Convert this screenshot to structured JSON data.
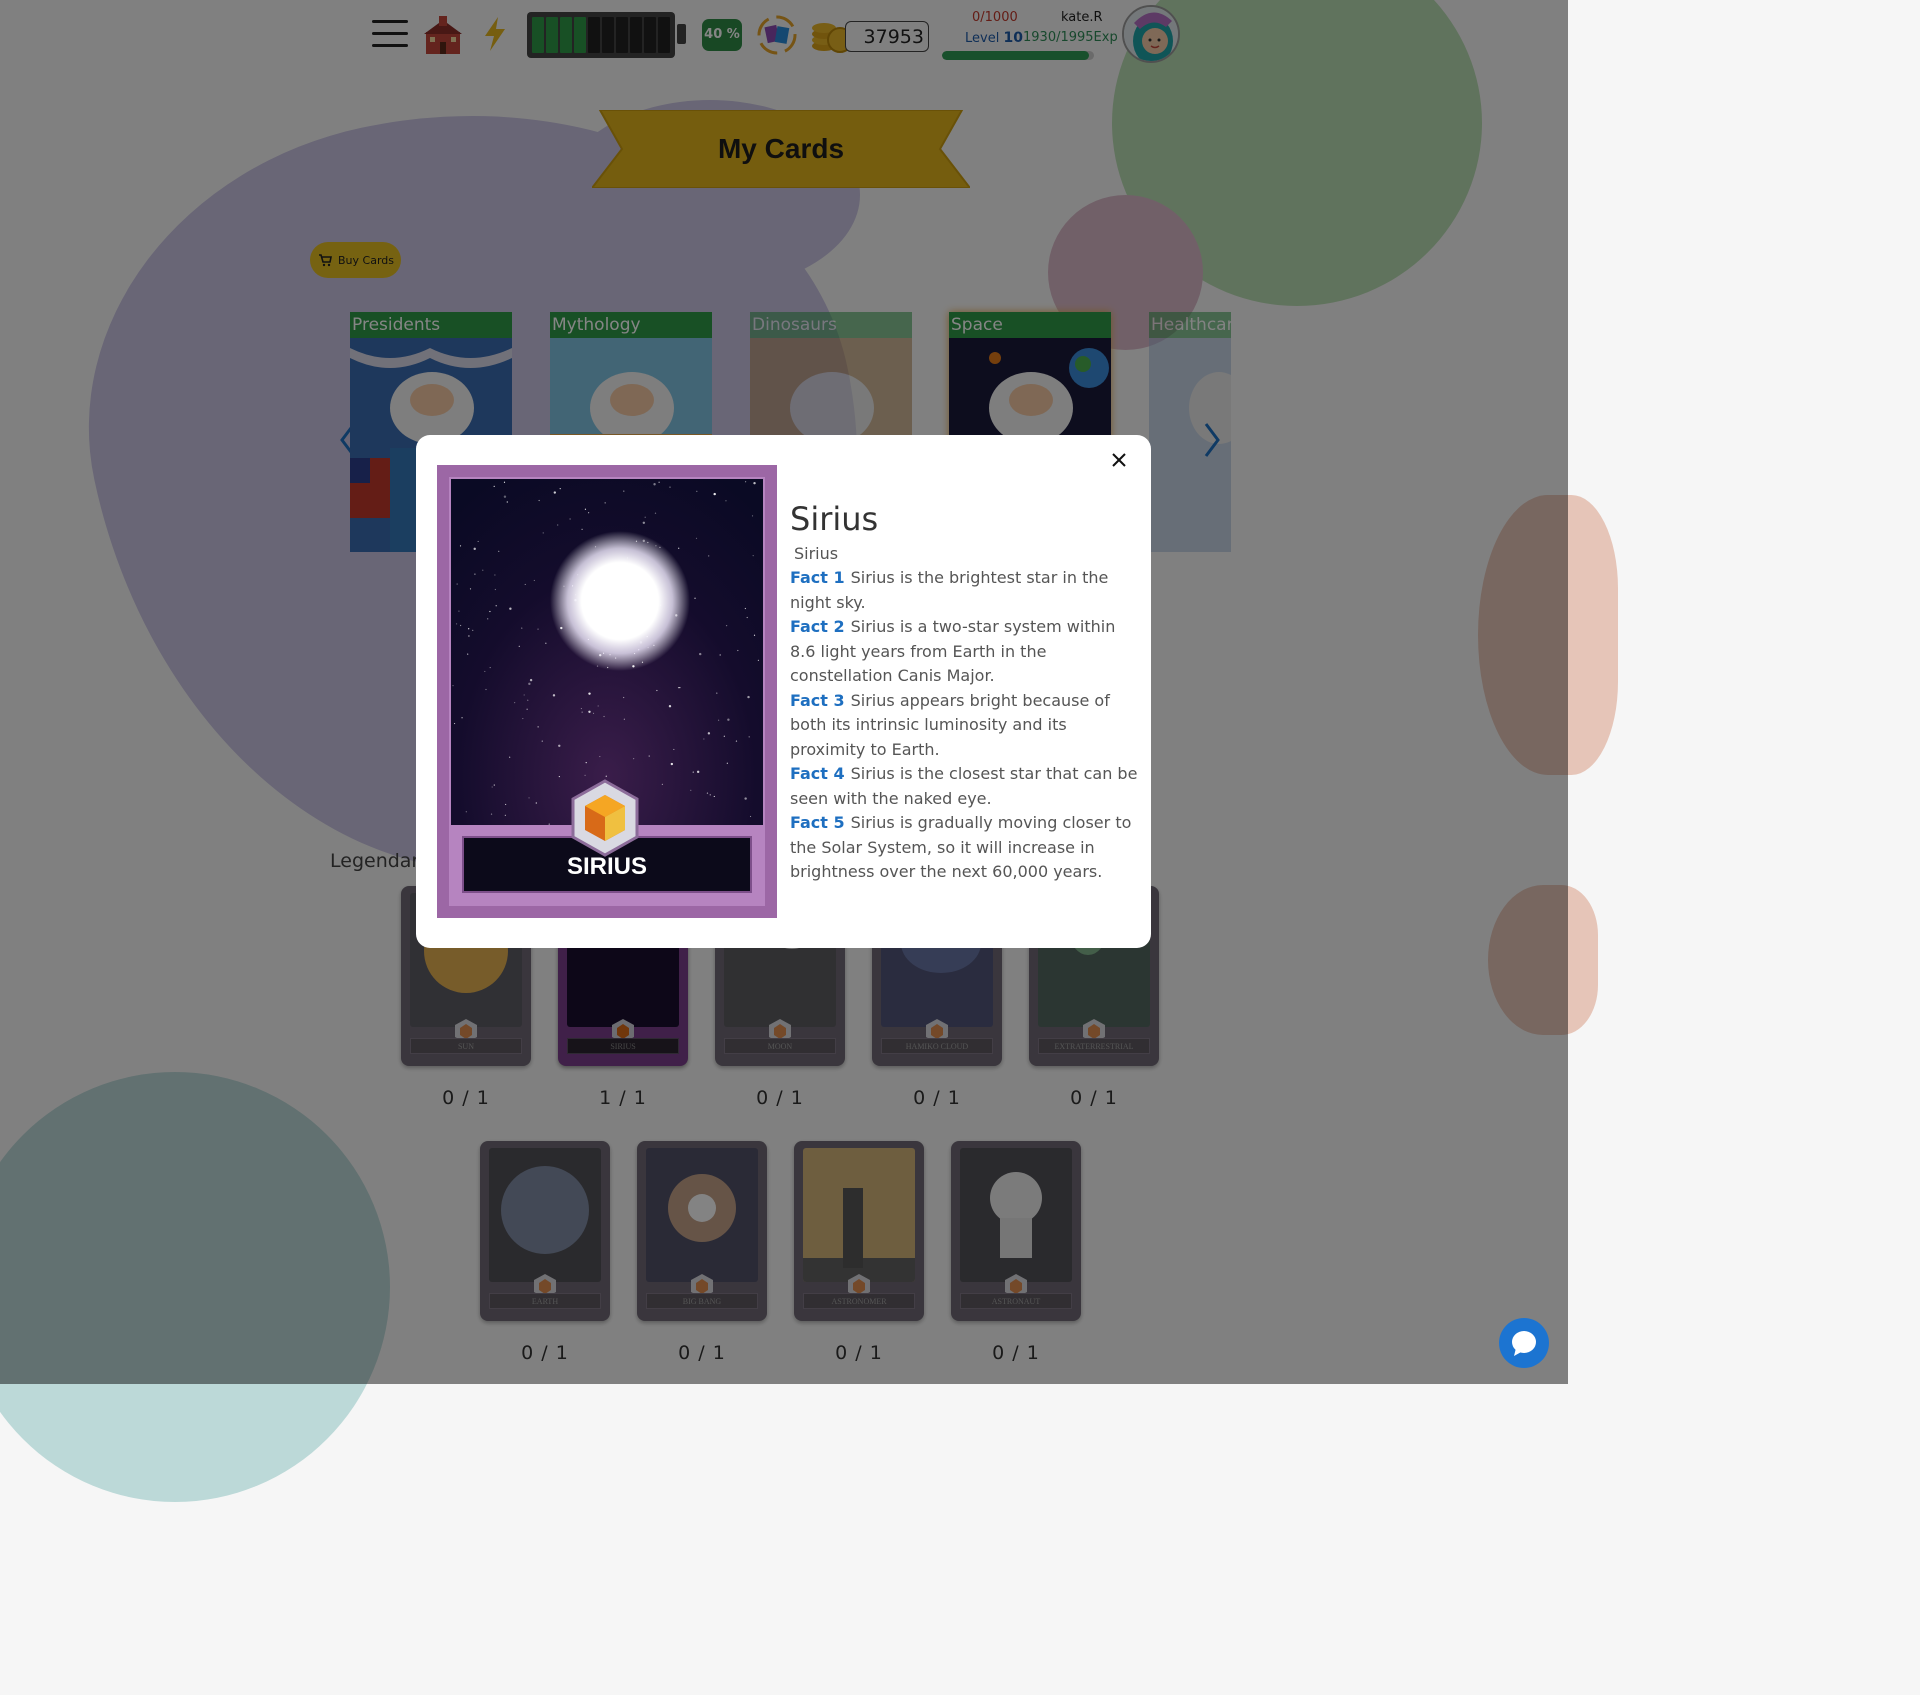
{
  "header": {
    "battery_percent": "40 %",
    "battery_level": 0.4,
    "coins": "37953",
    "energy": "0/1000",
    "username": "kate.R",
    "level_label": "Level",
    "level_value": "10",
    "exp": "1930/1995Exp",
    "exp_fraction": 0.967
  },
  "page": {
    "title": "My Cards",
    "buy_cards": "Buy Cards",
    "legendary_label": "Legendary"
  },
  "categories": [
    {
      "label": "Presidents"
    },
    {
      "label": "Mythology"
    },
    {
      "label": "Dinosaurs"
    },
    {
      "label": "Space"
    },
    {
      "label": "Healthcare"
    }
  ],
  "cards_row1": [
    {
      "name": "SUN",
      "count": "0 / 1"
    },
    {
      "name": "SIRIUS",
      "count": "1 / 1"
    },
    {
      "name": "MOON",
      "count": "0 / 1"
    },
    {
      "name": "HAMIKO CLOUD",
      "count": "0 / 1"
    },
    {
      "name": "EXTRATERRESTRIAL",
      "count": "0 / 1"
    }
  ],
  "cards_row2": [
    {
      "name": "EARTH",
      "count": "0 / 1"
    },
    {
      "name": "BIG BANG",
      "count": "0 / 1"
    },
    {
      "name": "ASTRONOMER",
      "count": "0 / 1"
    },
    {
      "name": "ASTRONAUT",
      "count": "0 / 1"
    }
  ],
  "modal": {
    "card_name": "SIRIUS",
    "title": "Sirius",
    "subtitle": "Sirius",
    "facts": [
      {
        "key": "Fact 1",
        "text": "Sirius is the brightest star in the night sky."
      },
      {
        "key": "Fact 2",
        "text": "Sirius is a two-star system within 8.6 light years from Earth in the constellation Canis Major."
      },
      {
        "key": "Fact 3",
        "text": "Sirius appears bright because of both its intrinsic luminosity and its proximity to Earth."
      },
      {
        "key": "Fact 4",
        "text": "Sirius is the closest star that can be seen with the naked eye."
      },
      {
        "key": "Fact 5",
        "text": "Sirius is gradually moving closer to the Solar System, so it will increase in brightness over the next 60,000 years."
      }
    ]
  },
  "colors": {
    "accent_blue": "#1e6fc0",
    "green": "#2e9a47",
    "gold": "#e2bd22",
    "card_purple": "#9c67a5"
  }
}
